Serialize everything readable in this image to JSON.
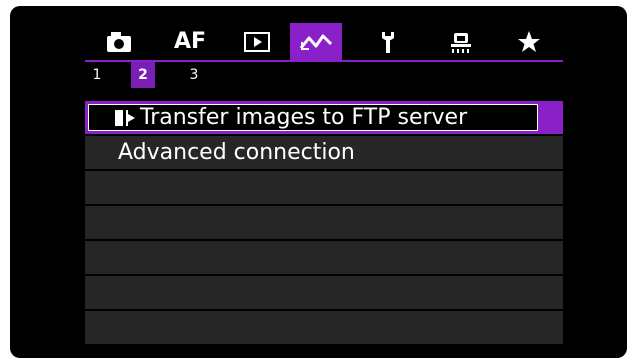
{
  "tabs": [
    {
      "name": "camera",
      "icon": "camera-icon"
    },
    {
      "name": "af",
      "label": "AF"
    },
    {
      "name": "playback",
      "icon": "play-icon"
    },
    {
      "name": "wireless",
      "icon": "wireless-icon",
      "active": true
    },
    {
      "name": "setup",
      "icon": "wrench-icon"
    },
    {
      "name": "custom",
      "icon": "custom-functions-icon"
    },
    {
      "name": "mymenu",
      "icon": "star-icon"
    }
  ],
  "subtabs": [
    "1",
    "2",
    "3"
  ],
  "active_subtab": "2",
  "menu": {
    "items": [
      {
        "label": "Transfer images to FTP server",
        "icon": "ftp-transfer-icon",
        "selected": true
      },
      {
        "label": "Advanced connection"
      },
      {
        "label": ""
      },
      {
        "label": ""
      },
      {
        "label": ""
      },
      {
        "label": ""
      },
      {
        "label": ""
      }
    ]
  },
  "colors": {
    "accent": "#8a20c8",
    "row_bg": "#262626",
    "screen_bg": "#000000"
  }
}
